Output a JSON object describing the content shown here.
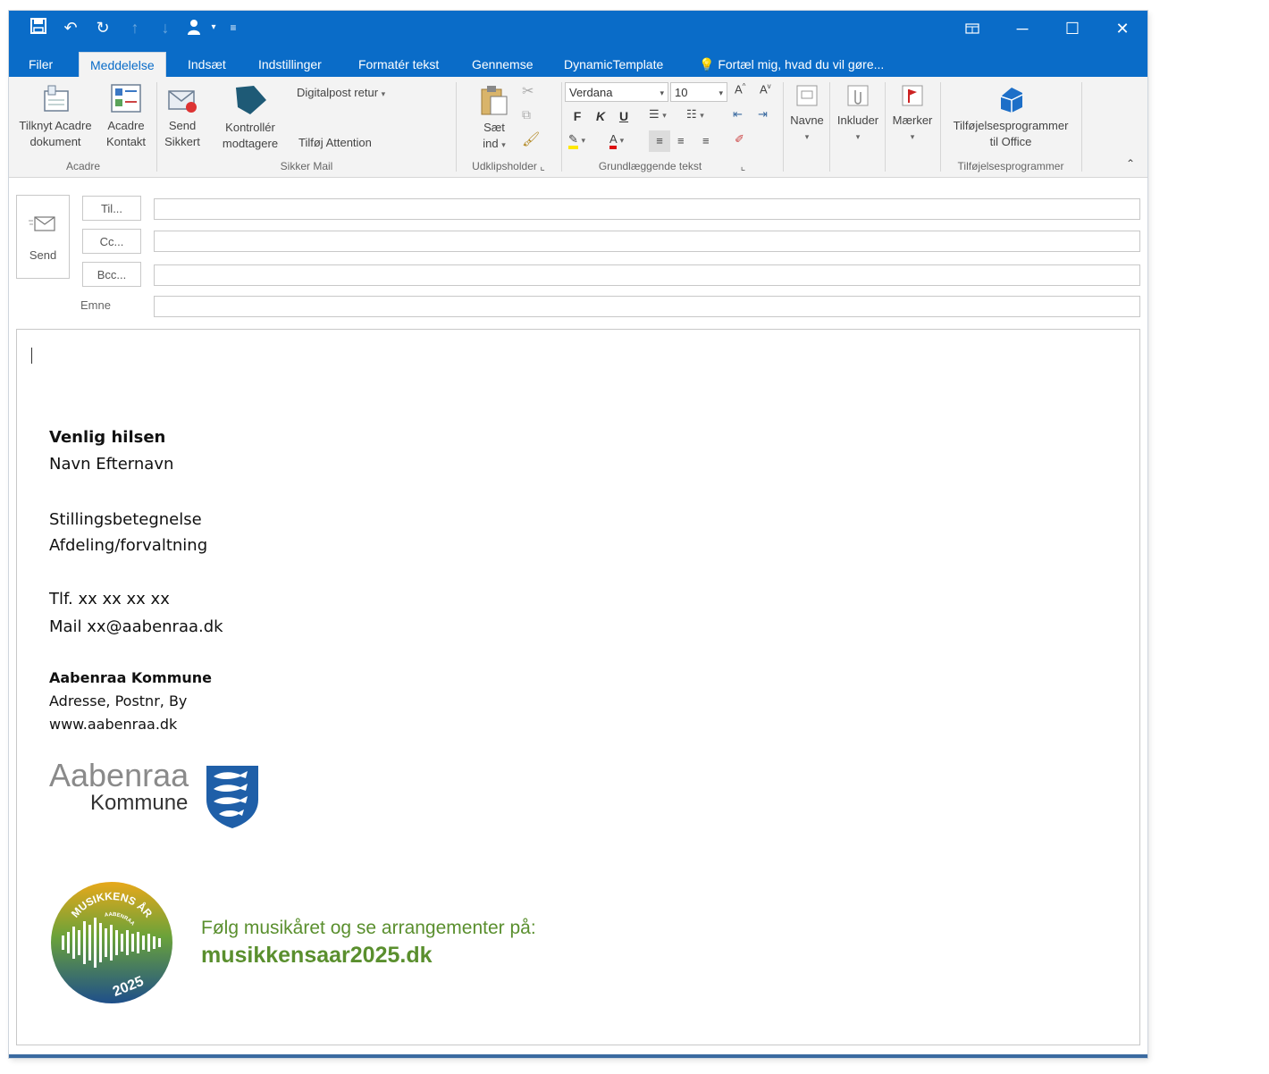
{
  "quick_access": {
    "icons": [
      "save-icon",
      "undo-icon",
      "redo-icon",
      "up-arrow-icon",
      "down-arrow-icon",
      "person-icon",
      "customize-icon"
    ]
  },
  "tabs": [
    {
      "label": "Filer"
    },
    {
      "label": "Meddelelse",
      "active": true
    },
    {
      "label": "Indsæt"
    },
    {
      "label": "Indstillinger"
    },
    {
      "label": "Formatér tekst"
    },
    {
      "label": "Gennemse"
    },
    {
      "label": "DynamicTemplate"
    }
  ],
  "tell_me": "Fortæl mig, hvad du vil gøre...",
  "ribbon": {
    "acadre": {
      "attach_label_1": "Tilknyt Acadre",
      "attach_label_2": "dokument",
      "contact_label_1": "Acadre",
      "contact_label_2": "Kontakt",
      "group": "Acadre"
    },
    "sikker_mail": {
      "send_label_1": "Send",
      "send_label_2": "Sikkert",
      "check_label_1": "Kontrollér",
      "check_label_2": "modtagere",
      "digitalpost": "Digitalpost retur",
      "attention": "Tilføj Attention",
      "group": "Sikker Mail"
    },
    "clipboard": {
      "paste_label_1": "Sæt",
      "paste_label_2": "ind",
      "group": "Udklipsholder"
    },
    "basic_text": {
      "font": "Verdana",
      "size": "10",
      "bold": "F",
      "italic": "K",
      "underline": "U",
      "group": "Grundlæggende tekst"
    },
    "names": "Navne",
    "include": "Inkluder",
    "tags": "Mærker",
    "addins": {
      "label_1": "Tilføjelsesprogrammer",
      "label_2": "til Office",
      "group": "Tilføjelsesprogrammer"
    }
  },
  "compose": {
    "send": "Send",
    "to": "Til...",
    "cc": "Cc...",
    "bcc": "Bcc...",
    "subject": "Emne"
  },
  "signature": {
    "greeting": "Venlig hilsen",
    "name": "Navn Efternavn",
    "title": "Stillingsbetegnelse",
    "department": "Afdeling/forvaltning",
    "phone": "Tlf. xx xx xx xx",
    "mail": "Mail xx@aabenraa.dk",
    "org": "Aabenraa Kommune",
    "address": "Adresse, Postnr, By",
    "web": "www.aabenraa.dk",
    "logo_line_1": "Aabenraa",
    "logo_line_2": "Kommune",
    "badge_top": "MUSIKKENS ÅR",
    "badge_mid": "AABENRAA",
    "badge_year": "2025",
    "music_line": "Følg musikåret og se arrangementer på:",
    "music_link": "musikkensaar2025.dk"
  },
  "colors": {
    "accent": "#0a6cc8",
    "ribbon_bg": "#f3f3f3",
    "music_green": "#5a8f2e"
  }
}
